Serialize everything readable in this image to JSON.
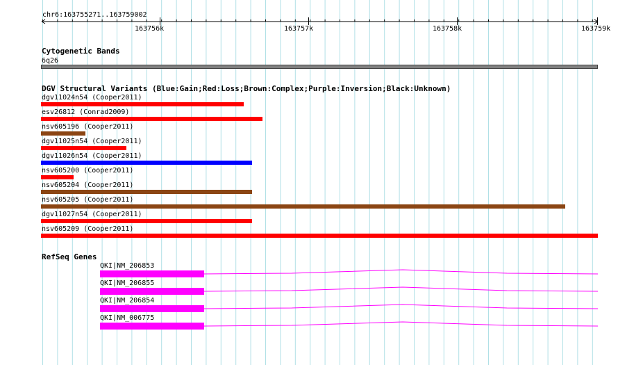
{
  "ruler": {
    "location": "chr6:163755271..163759002",
    "ticks": [
      "163756k",
      "163757k",
      "163758k",
      "163759k"
    ]
  },
  "cytoband": {
    "title": "Cytogenetic Bands",
    "band": "6q26"
  },
  "dgv": {
    "title": "DGV Structural Variants (Blue:Gain;Red:Loss;Brown:Complex;Purple:Inversion;Black:Unknown)",
    "colors": {
      "gain": "#0000ff",
      "loss": "#ff0000",
      "complex": "#8b4513",
      "inversion": "#800080",
      "unknown": "#000000"
    },
    "items": [
      {
        "label": "dgv11024n54 (Cooper2011)",
        "type": "loss"
      },
      {
        "label": "esv26812 (Conrad2009)",
        "type": "loss"
      },
      {
        "label": "nsv605196 (Cooper2011)",
        "type": "complex"
      },
      {
        "label": "dgv11025n54 (Cooper2011)",
        "type": "loss"
      },
      {
        "label": "dgv11026n54 (Cooper2011)",
        "type": "gain"
      },
      {
        "label": "nsv605200 (Cooper2011)",
        "type": "loss"
      },
      {
        "label": "nsv605204 (Cooper2011)",
        "type": "complex"
      },
      {
        "label": "nsv605205 (Cooper2011)",
        "type": "complex"
      },
      {
        "label": "dgv11027n54 (Cooper2011)",
        "type": "loss"
      },
      {
        "label": "nsv605209 (Cooper2011)",
        "type": "loss"
      }
    ]
  },
  "refseq": {
    "title": "RefSeq Genes",
    "color": "#ff00ff",
    "genes": [
      {
        "label": "QKI|NM_206853"
      },
      {
        "label": "QKI|NM_206855"
      },
      {
        "label": "QKI|NM_206854"
      },
      {
        "label": "QKI|NM_006775"
      }
    ]
  }
}
